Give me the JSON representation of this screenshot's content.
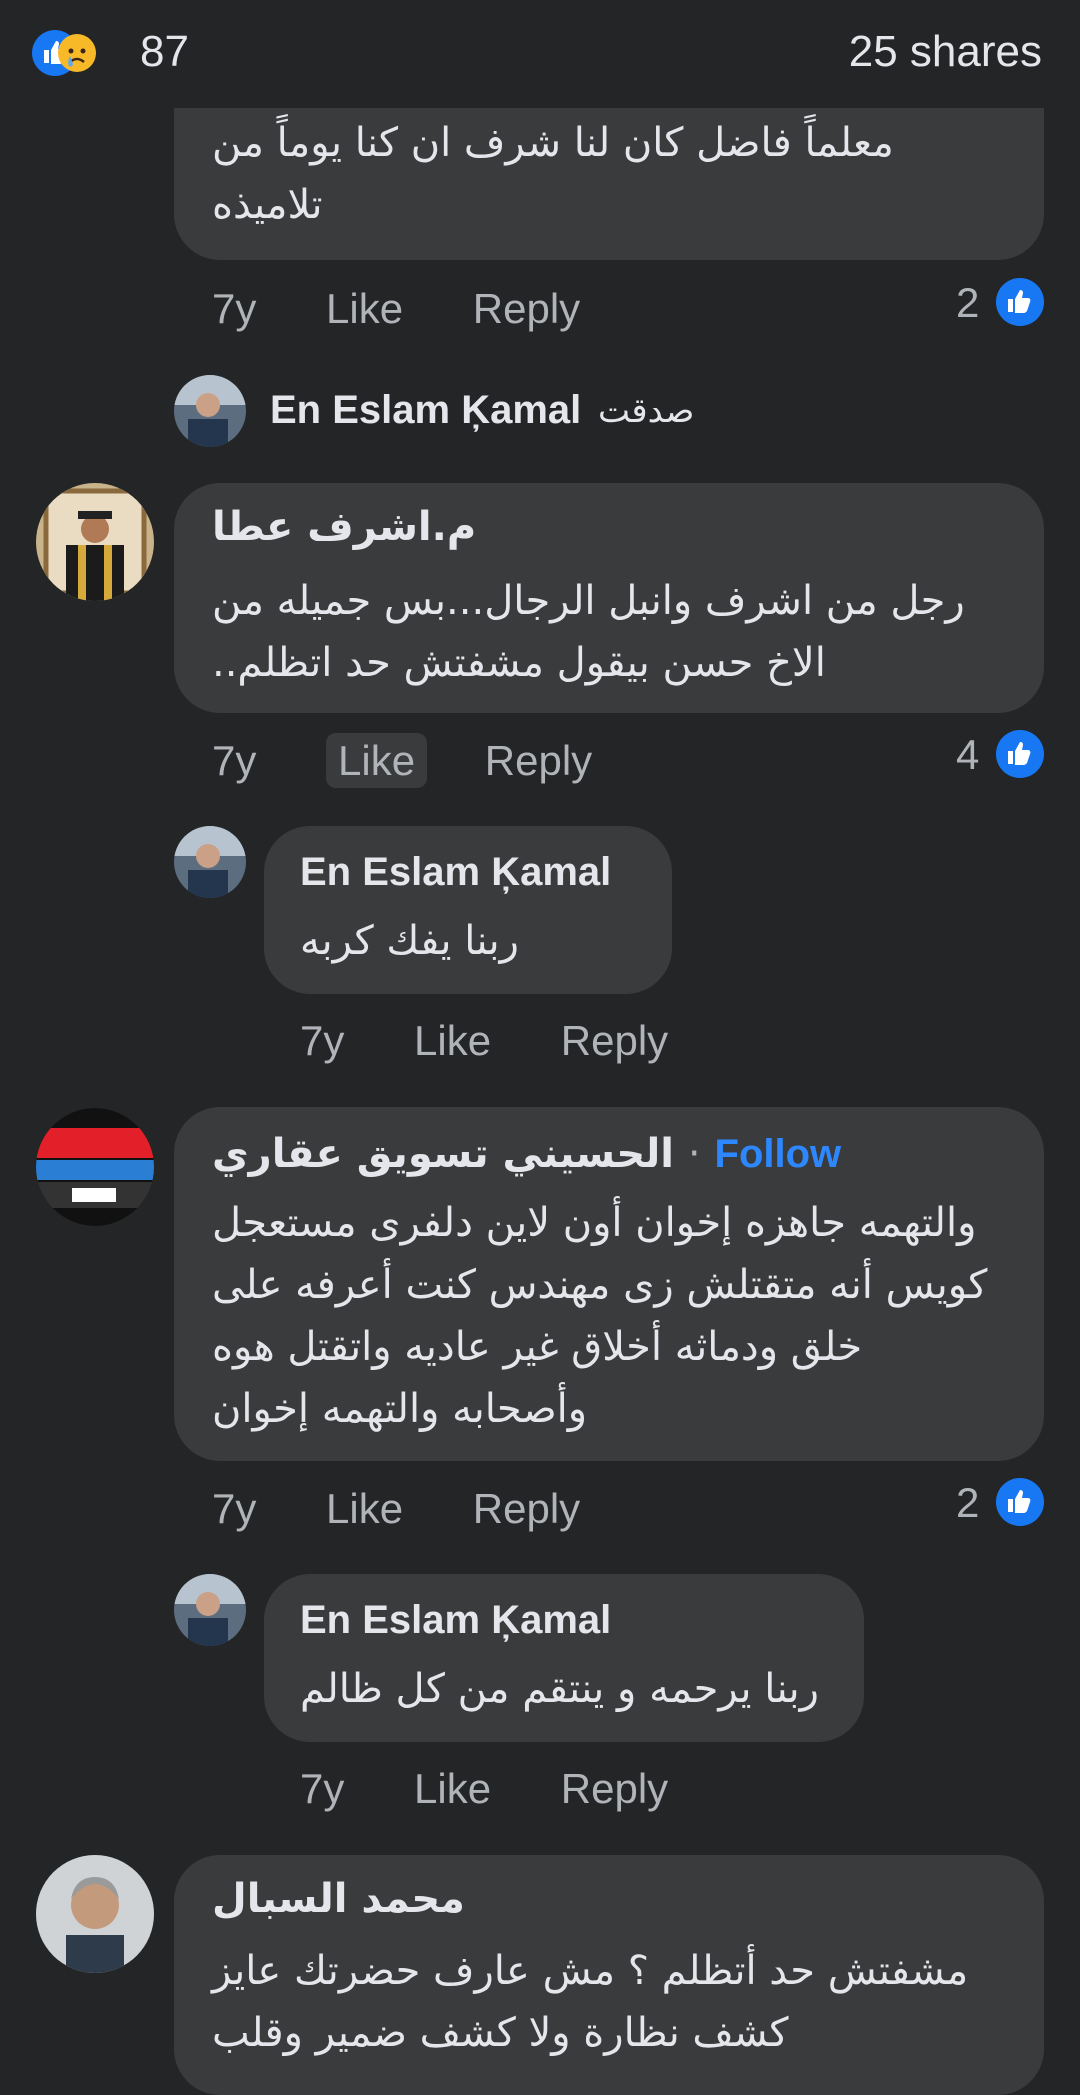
{
  "header": {
    "reaction_count": "87",
    "shares": "25 shares"
  },
  "colors": {
    "background": "#242526",
    "bubble": "#3a3b3c",
    "text": "#e4e6eb",
    "secondary": "#b0b3b8",
    "link": "#2d88ff",
    "like_blue": "#1877f2"
  },
  "comments": [
    {
      "text_lines": [
        "معلماً فاضل كان لنا شرف ان كنا يوماً من",
        "تلاميذه"
      ],
      "time": "7y",
      "like": "Like",
      "reply": "Reply",
      "reactions": "2"
    },
    {
      "reply_preview_author": "En Eslam Ķamal",
      "reply_preview_text": "صدقت"
    },
    {
      "author": "م.اشرف عطا",
      "text_lines": [
        "رجل من اشرف وانبل الرجال...بس جميله من",
        "الاخ حسن  بيقول  مشفتش حد اتظلم.."
      ],
      "time": "7y",
      "like": "Like",
      "reply": "Reply",
      "reactions": "4"
    },
    {
      "author": "En Eslam Ķamal",
      "text_lines": [
        "ربنا يفك كربه"
      ],
      "time": "7y",
      "like": "Like",
      "reply": "Reply"
    },
    {
      "author": "الحسيني تسويق عقاري",
      "follow": "Follow",
      "separator": "·",
      "text_lines": [
        "والتهمه جاهزه إخوان أون لاين دلفرى مستعجل",
        "كويس أنه متقتلش زى مهندس كنت أعرفه على",
        "خلق ودماثه أخلاق غير عاديه واتقتل هوه",
        "وأصحابه والتهمه إخوان"
      ],
      "time": "7y",
      "like": "Like",
      "reply": "Reply",
      "reactions": "2"
    },
    {
      "author": "En Eslam Ķamal",
      "text_lines": [
        "ربنا يرحمه و ينتقم من كل ظالم"
      ],
      "time": "7y",
      "like": "Like",
      "reply": "Reply"
    },
    {
      "author": "محمد السبال",
      "text_lines": [
        "مشفتش حد أتظلم ؟ مش عارف حضرتك عايز",
        "كشف نظارة ولا كشف ضمير وقلب"
      ]
    }
  ]
}
